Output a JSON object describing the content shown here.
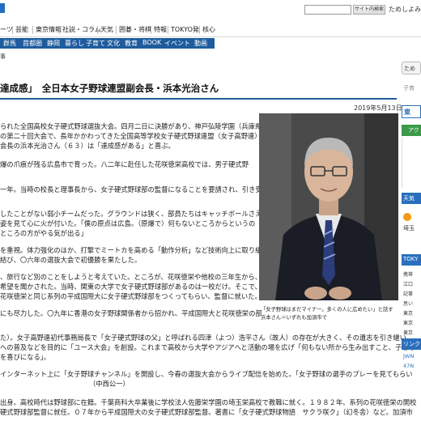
{
  "header": {
    "user_text": "ためしよみ・新聞",
    "search_button_label": "サイト内検索",
    "search_placeholder": ""
  },
  "nav_primary": [
    "ーツ",
    "芸能",
    "東京情報",
    "社説・コラム",
    "天気",
    "囲碁・将棋",
    "特報",
    "TOKYO発",
    "核心"
  ],
  "nav_secondary": [
    "群馬",
    "首都圏",
    "静岡",
    "暮らし",
    "子育て",
    "文化",
    "教育",
    "BOOK",
    "イベント",
    "動画"
  ],
  "breadcrumb": "事",
  "article": {
    "headline": "達成感」　全日本女子野球連盟副会長・浜本光治さん",
    "date": "2019年5月13日",
    "paragraphs": [
      "られた全国高校女子硬式野球選抜大会。四月二日に決勝があり、神戸弘陵学園（兵庫県）",
      "の第二十回大会で、長年かかわってきた全国高等学校女子硬式野球連盟（女子高野連）",
      "会長の浜本光治さん（６３）は「達成感がある」と喜ぶ。",
      "爆の爪痕が残る広島市で育った。八二年に赴任した花咲徳栄高校では、男子硬式野",
      "一年。当時の校長と理事長から、女子硬式野球部の監督になることを要請され、引き受け",
      "したことがない弱小チームだった。グラウンドは狭く、部員たちはキャッチボールさえ",
      "姿を見て心に火が付いた。「僕の原点は広島。（原爆で）何もないところからというの",
      "ところの方がやる気が出る」",
      "を重視。体力強化のほか、打撃でミートカを高める「動作分析」など技術向上に取り組",
      "結び、〇六年の選抜大会で初優勝を果たした。",
      "、旅行など別のことをしようと考えていた。ところが、花咲徳栄や他校の三年生から、",
      "希望を聞かされた。当時、関東の大学で女子硬式野球部があるのは一校だけ。そこで、大",
      "花咲徳栄と同じ系列の平成国際大に女子硬式野球部をつくってもらい、監督に就いた。",
      "にも尽力した。〇九年に香港の女子野球関係者から招かれ、平成国際大と花咲徳栄の部",
      "た）。女子高野連初代事務局長で「女子硬式野球の父」と呼ばれる四津（よつ）浩平さん（故人）の存在が大きく、その遺志を引き継い",
      "への普及などを目的に「ユース大会」を創設。これまで高校から大学やアジアへと活動の場を広げ「何もない所から生み出すこと、子ども",
      "を喜びになる」。",
      "インターネット上に「女子野球チャンネル」を開設し、今春の選抜大会からライブ配信を始めた。「女子野球の選手のプレーを見てもらい",
      "（中西公一）",
      "出身。高校時代は野球部に在籍。千葉商科大卒業後に学校法人佐藤栄学園の埼玉栄高校で教職に就く。１９８２年、系列の花咲徳栄の開校",
      "硬式野球部監督に就任。０７年から平成国際大の女子硬式野球部監督。著書に「女子硬式野球物語　サクラ咲ク」（幻冬舎）など。加須市"
    ]
  },
  "photo": {
    "caption": "「女子野球はまだマイナー。多くの人に広めたい」と話す浜本さん＝いずれも加須市で"
  },
  "sidebar": {
    "items": [
      "ため",
      "子育",
      "東",
      "アク",
      "天気",
      "埼玉",
      "TOKY",
      "携帯",
      "江口",
      "記事",
      "思い",
      "東京",
      "東京",
      "東京",
      "リンク",
      "JWN",
      "47N"
    ]
  },
  "colors": {
    "brand_blue": "#1f5c9e",
    "sidebar_blue": "#2a6fbd",
    "sidebar_green": "#3c9a4a",
    "sidebar_orange": "#f29a17"
  }
}
